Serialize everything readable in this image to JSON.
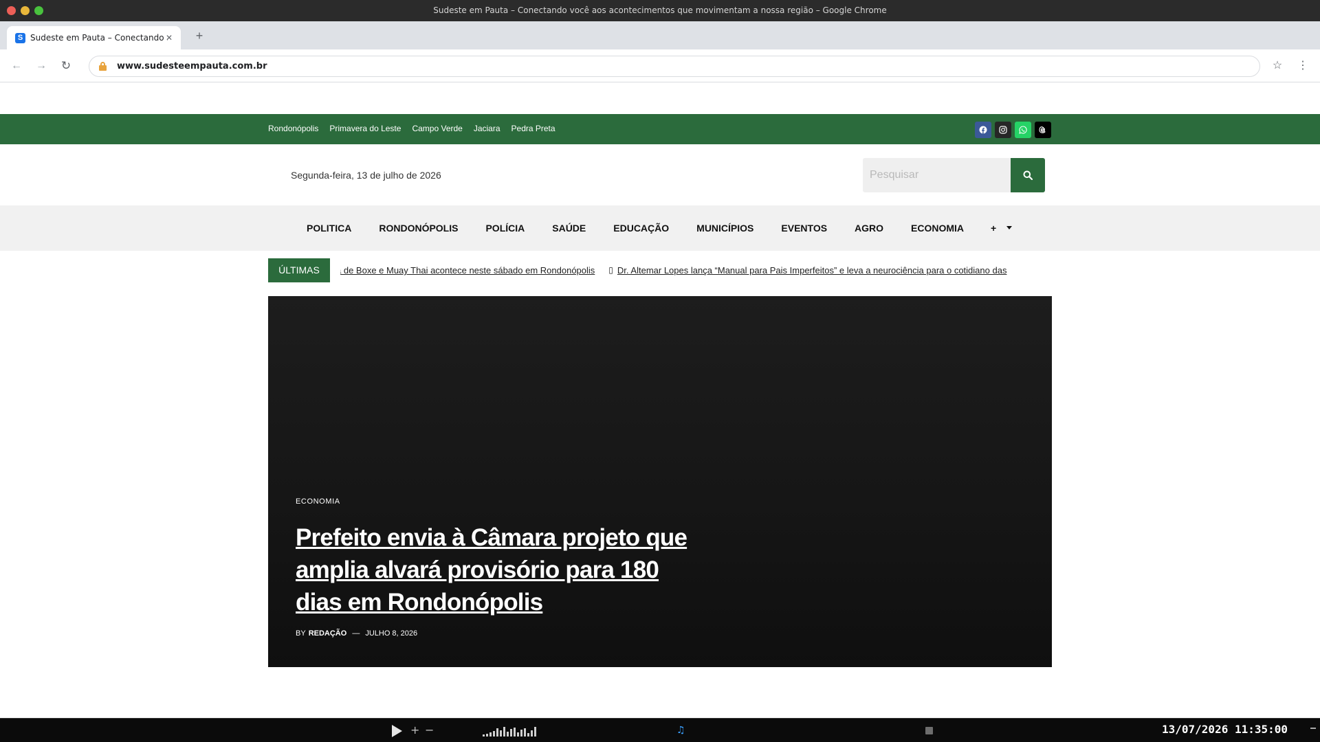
{
  "browser": {
    "window_title": "Sudeste em Pauta – Conectando você aos acontecimentos que movimentam a nossa região – Google Chrome",
    "tab_title": "Sudeste em Pauta – Conectando ...",
    "tab_favicon": "S",
    "url": "www.sudesteempauta.com.br"
  },
  "topbar": {
    "cities": [
      "Rondonópolis",
      "Primavera do Leste",
      "Campo Verde",
      "Jaciara",
      "Pedra Preta"
    ],
    "socials": [
      "facebook-icon",
      "instagram-icon",
      "whatsapp-icon",
      "threads-icon"
    ]
  },
  "header": {
    "date": "Segunda-feira, 13 de julho de 2026",
    "search_placeholder": "Pesquisar"
  },
  "mainnav": {
    "items": [
      "POLITICA",
      "RONDONÓPOLIS",
      "POLÍCIA",
      "SAÚDE",
      "EDUCAÇÃO",
      "MUNICÍPIOS",
      "EVENTOS",
      "AGRO",
      "ECONOMIA"
    ],
    "more_label": "+"
  },
  "ticker": {
    "label": "ÚLTIMAS",
    "items": [
      "a de Boxe e Muay Thai acontece neste sábado em Rondonópolis",
      "Dr. Altemar Lopes lança “Manual para Pais Imperfeitos” e leva a neurociência para o cotidiano das"
    ]
  },
  "hero": {
    "category": "ECONOMIA",
    "title": "Prefeito envia à Câmara projeto que amplia alvará provisório para 180 dias em Rondonópolis",
    "by": "BY",
    "author": "REDAÇÃO",
    "separator": "—",
    "date": "JULHO 8, 2026"
  },
  "taskbar": {
    "clock": "13/07/2026 11:35:00",
    "plus": "+",
    "minus": "−",
    "music": "♫"
  },
  "colors": {
    "brand_green": "#2b6b3c",
    "nav_bg": "#f1f1f1",
    "hero_bg": "#1a1a1a"
  }
}
